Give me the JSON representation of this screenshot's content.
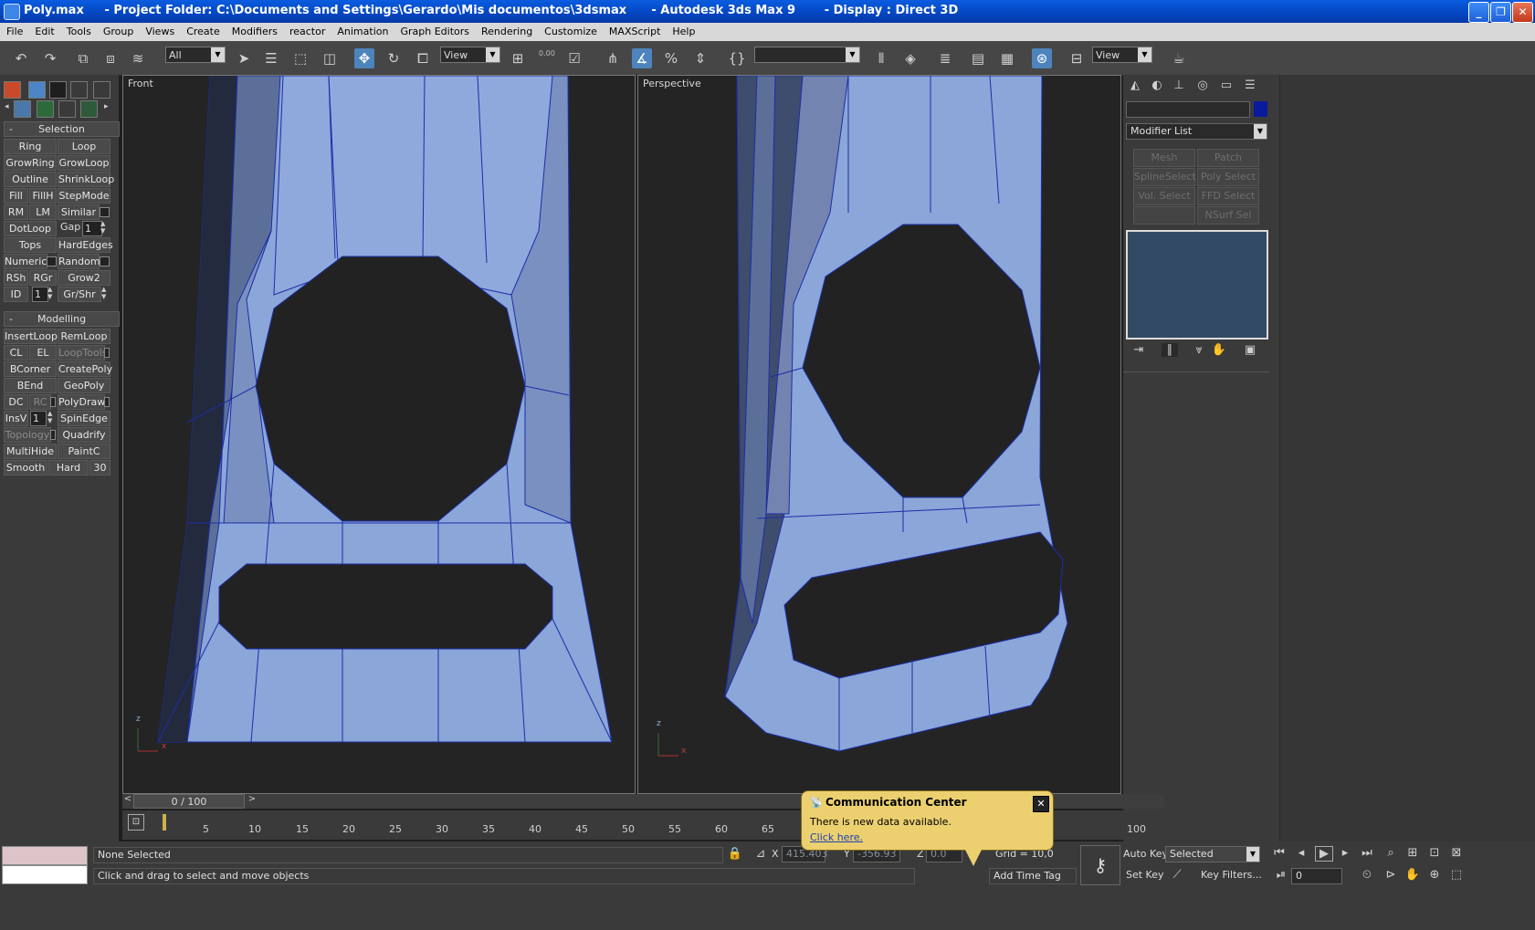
{
  "window": {
    "title": "Poly.max     - Project Folder: C:\\Documents and Settings\\Gerardo\\Mis documentos\\3dsmax      - Autodesk 3ds Max 9       - Display : Direct 3D",
    "buttons": [
      "minimize",
      "restore",
      "close"
    ]
  },
  "menu": [
    "File",
    "Edit",
    "Tools",
    "Group",
    "Views",
    "Create",
    "Modifiers",
    "reactor",
    "Animation",
    "Graph Editors",
    "Rendering",
    "Customize",
    "MAXScript",
    "Help"
  ],
  "toolbar": {
    "selection_filter": "All",
    "ref_coord": "View",
    "named_selection": "",
    "render_view": "View",
    "spinner_value": "0.00"
  },
  "left_panel": {
    "selection_title": "Selection",
    "selection_buttons": {
      "ring": "Ring",
      "loop": "Loop",
      "growring": "GrowRing",
      "growloop": "GrowLoop",
      "outline": "Outline",
      "shrinkloop": "ShrinkLoop",
      "fill": "Fill",
      "fillh": "FillH",
      "stepmode": "StepMode",
      "rm": "RM",
      "lm": "LM",
      "similar": "Similar",
      "dotloop": "DotLoop",
      "gap": "Gap",
      "gap_value": "1",
      "tops": "Tops",
      "hardedges": "HardEdges",
      "numeric": "Numeric",
      "random": "Random",
      "rsh": "RSh",
      "rgr": "RGr",
      "grow2": "Grow2",
      "id": "ID",
      "id_value": "1",
      "grshr": "Gr/Shr"
    },
    "modelling_title": "Modelling",
    "modelling_buttons": {
      "insertloop": "InsertLoop",
      "remloop": "RemLoop",
      "cl": "CL",
      "el": "EL",
      "looptools": "LoopTools",
      "bcorner": "BCorner",
      "createpoly": "CreatePoly",
      "bend": "BEnd",
      "geopoly": "GeoPoly",
      "dc": "DC",
      "rc": "RC",
      "polydraw": "PolyDraw",
      "insv": "InsV",
      "insv_value": "1",
      "spinedge": "SpinEdge",
      "topology": "Topology",
      "quadrify": "Quadrify",
      "multihide": "MultiHide",
      "paintc": "PaintC",
      "smooth": "Smooth",
      "hard": "Hard",
      "thirty": "30"
    }
  },
  "viewports": {
    "front": "Front",
    "perspective": "Perspective",
    "axis_x": "x",
    "axis_z": "z"
  },
  "right_panel": {
    "name_field": "",
    "object_color": "#0a1a9c",
    "modifier_list": "Modifier List",
    "modifier_buttons": [
      "Mesh Select",
      "Patch Select",
      "SplineSelect",
      "Poly Select",
      "Vol. Select",
      "FFD Select",
      "",
      "NSurf Sel"
    ]
  },
  "time_slider": {
    "label": "0 / 100",
    "ticks": [
      "5",
      "10",
      "15",
      "20",
      "25",
      "30",
      "35",
      "40",
      "45",
      "50",
      "55",
      "60",
      "65",
      "100"
    ]
  },
  "status": {
    "selection": "None Selected",
    "prompt": "Click and drag to select and move objects",
    "x_label": "X",
    "x_value": "415.403",
    "y_label": "Y",
    "y_value": "-356.93",
    "z_label": "Z",
    "z_value": "0.0",
    "grid": "Grid = 10,0",
    "add_time_tag": "Add Time Tag",
    "auto_key": "Auto Key",
    "set_key": "Set Key",
    "key_mode": "Selected",
    "key_filters": "Key Filters...",
    "frame": "0"
  },
  "comm_center": {
    "title": "Communication Center",
    "message": "There is new data available.",
    "link": "Click here."
  }
}
